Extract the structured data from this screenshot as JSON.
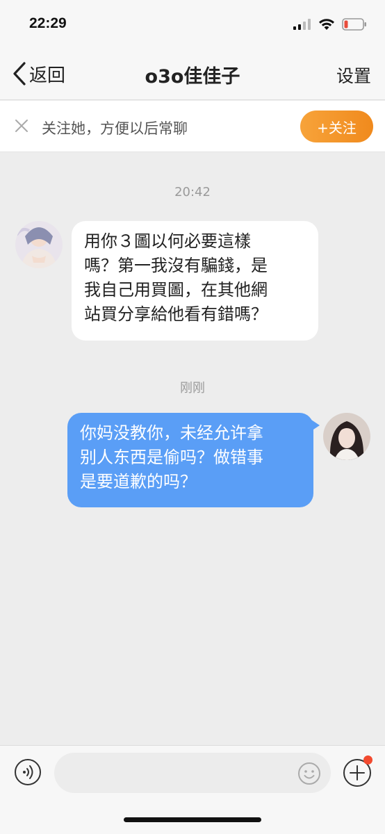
{
  "status_bar": {
    "time": "22:29",
    "battery_color": "#e74c3c"
  },
  "nav": {
    "back_label": "返回",
    "title": "o3o佳佳子",
    "settings_label": "设置"
  },
  "follow_banner": {
    "text": "关注她，方便以后常聊",
    "button_label": "+关注",
    "button_color": "#f39a2b"
  },
  "messages": [
    {
      "timestamp": "20:42",
      "sender": "other",
      "lines": [
        "用你３圖以何必要這樣",
        "嗎？第一我沒有騙錢，是",
        "我自己用買圖，在其他網",
        "站買分享給他看有錯嗎？"
      ]
    },
    {
      "timestamp": "刚刚",
      "sender": "me",
      "lines": [
        "你妈没教你，未经允许拿",
        "别人东西是偷吗？做错事",
        "是要道歉的吗？"
      ],
      "bubble_color": "#5a9ef6"
    }
  ],
  "input_bar": {
    "placeholder": "",
    "voice_icon": "voice-icon",
    "emoji_icon": "emoji-icon",
    "plus_icon": "plus-icon"
  }
}
